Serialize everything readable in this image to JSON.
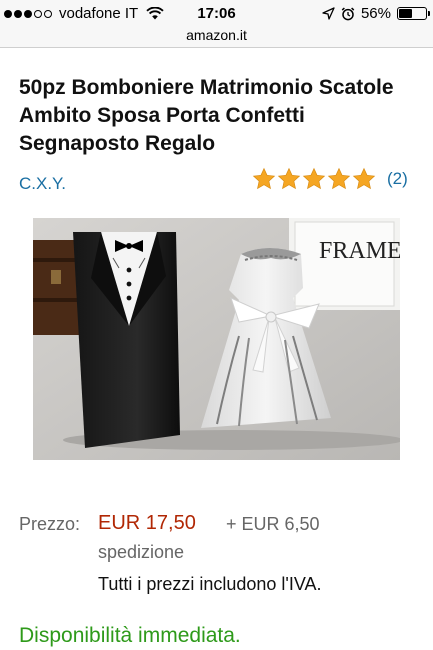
{
  "status_bar": {
    "carrier": "vodafone IT",
    "time": "17:06",
    "battery_percent": "56%",
    "battery_level": 0.56,
    "signal_bars_filled": 3,
    "signal_bars_total": 5
  },
  "url_bar": {
    "domain": "amazon.it"
  },
  "product": {
    "title": "50pz Bomboniere Matrimonio Scatole Ambito Sposa Porta Confetti Segnaposto Regalo",
    "brand": "C.X.Y.",
    "rating_stars": 5,
    "review_count": "(2)",
    "image_text": "FRAME"
  },
  "pricing": {
    "price_label": "Prezzo:",
    "price": "EUR 17,50",
    "shipping_cost": "+ EUR 6,50",
    "shipping_word": "spedizione",
    "vat_note": "Tutti i prezzi includono l'IVA."
  },
  "availability": "Disponibilità immediata.",
  "colors": {
    "price": "#b12704",
    "link": "#1a6fa3",
    "availability": "#2e9a1a",
    "star": "#f5a623"
  }
}
